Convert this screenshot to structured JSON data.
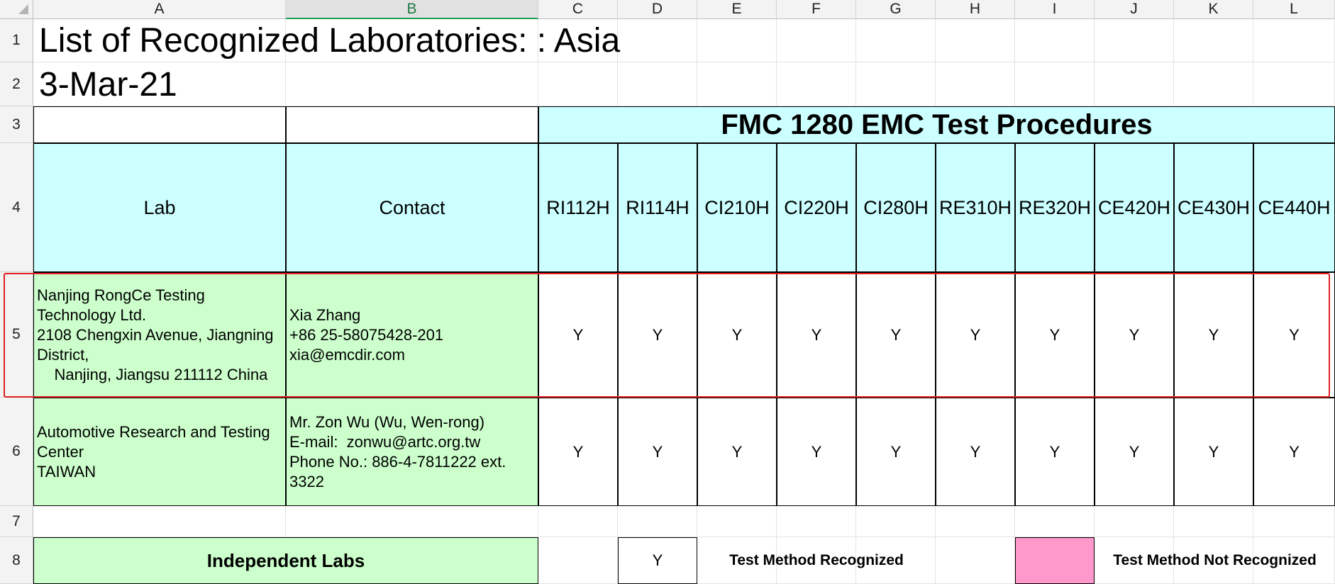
{
  "columns": [
    "A",
    "B",
    "C",
    "D",
    "E",
    "F",
    "G",
    "H",
    "I",
    "J",
    "K",
    "L"
  ],
  "rows": [
    "1",
    "2",
    "3",
    "4",
    "5",
    "6",
    "7",
    "8"
  ],
  "title": "List of Recognized Laboratories: : Asia",
  "date": "3-Mar-21",
  "section_header": "FMC 1280 EMC Test Procedures",
  "table_headers": {
    "lab": "Lab",
    "contact": "Contact",
    "procedures": [
      "RI112H",
      "RI114H",
      "CI210H",
      "CI220H",
      "CI280H",
      "RE310H",
      "RE320H",
      "CE420H",
      "CE430H",
      "CE440H"
    ]
  },
  "labs": [
    {
      "lab_lines": [
        "Nanjing RongCe Testing",
        "Technology Ltd.",
        "2108 Chengxin Avenue, Jiangning",
        "District,",
        "    Nanjing, Jiangsu 211112 China"
      ],
      "contact_lines": [
        "Xia Zhang",
        "+86 25-58075428-201",
        "xia@emcdir.com"
      ],
      "results": [
        "Y",
        "Y",
        "Y",
        "Y",
        "Y",
        "Y",
        "Y",
        "Y",
        "Y",
        "Y"
      ]
    },
    {
      "lab_lines": [
        "Automotive Research and Testing",
        "Center",
        "TAIWAN"
      ],
      "contact_lines": [
        "Mr. Zon Wu (Wu, Wen-rong)",
        "E-mail:  zonwu@artc.org.tw",
        "Phone No.: 886-4-7811222 ext.",
        "3322"
      ],
      "results": [
        "Y",
        "Y",
        "Y",
        "Y",
        "Y",
        "Y",
        "Y",
        "Y",
        "Y",
        "Y"
      ]
    }
  ],
  "legend": {
    "independent_labs": "Independent Labs",
    "recognized_symbol": "Y",
    "recognized_label": "Test Method Recognized",
    "not_recognized_label": "Test Method Not Recognized"
  },
  "colors": {
    "header_fill": "#ccffff",
    "lab_fill": "#ccffcc",
    "not_recognized_fill": "#ff99cc",
    "selection_border": "#e02020",
    "active_column": "#1f9d55"
  }
}
